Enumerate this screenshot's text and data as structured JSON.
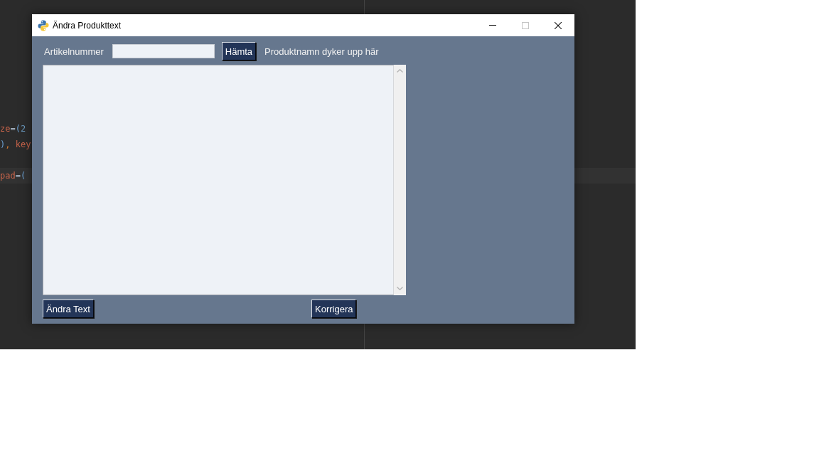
{
  "editor": {
    "lines": [
      {
        "current": false,
        "segments": [
          {
            "kind": "name",
            "text": "ze"
          },
          {
            "kind": "operator",
            "text": "="
          },
          {
            "kind": "bracket",
            "text": "("
          },
          {
            "kind": "number",
            "text": "2"
          }
        ]
      },
      {
        "current": false,
        "segments": [
          {
            "kind": "bracket",
            "text": ")"
          },
          {
            "kind": "punct",
            "text": ", "
          },
          {
            "kind": "name",
            "text": "key"
          }
        ]
      },
      {
        "current": true,
        "segments": [
          {
            "kind": "name",
            "text": "pad"
          },
          {
            "kind": "operator",
            "text": "="
          },
          {
            "kind": "bracket",
            "text": "("
          }
        ]
      }
    ]
  },
  "window": {
    "title": "Ändra Produkttext",
    "controls": [
      {
        "kind": "minimize",
        "disabled": false
      },
      {
        "kind": "maximize",
        "disabled": true
      },
      {
        "kind": "close",
        "disabled": false
      }
    ]
  },
  "form": {
    "article_label": "Artikelnummer",
    "fetch_button": "Hämta",
    "product_name": "Produktnamn dyker upp här",
    "buttons": [
      "Ändra Text",
      "Korrigera"
    ]
  }
}
